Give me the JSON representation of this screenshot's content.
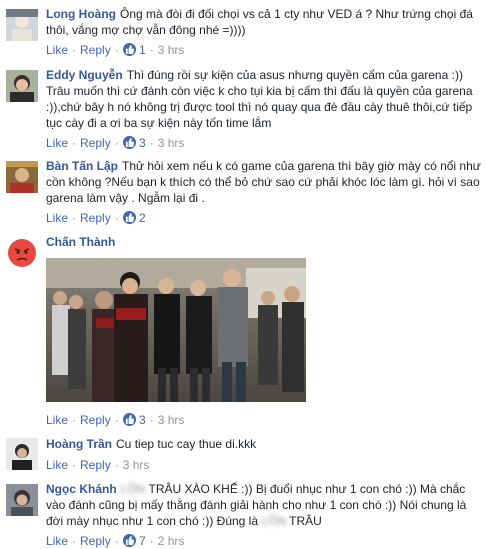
{
  "comments": [
    {
      "author": "Long Hoàng",
      "text": "Ông mà đòi đi đối chọi vs cả 1 cty như VED á ? Như trứng chọi đá thôi, vắng mợ chợ vẫn đông nhé =))))",
      "like_label": "Like",
      "reply_label": "Reply",
      "like_count": "1",
      "time": "3 hrs"
    },
    {
      "author": "Eddy Nguyễn",
      "text": "Thì đúng rồi sự kiện của asus nhưng quyền cấm của garena :)) Trâu muốn thì cứ đánh còn việc k cho tụi kia bị cấm thì đấu là quyền của garena :)),chứ bây h nó không trị được tool thì nó quay qua đè đầu cày thuê thôi,cứ tiếp tục cày đi a ơi ba sự kiện này tốn time lắm",
      "like_label": "Like",
      "reply_label": "Reply",
      "like_count": "3",
      "time": "3 hrs"
    },
    {
      "author": "Bàn Tấn Lập",
      "text": "Thử hỏi xem nếu k có game của garena thì bây giờ mày có nổi như cồn không ?Nếu bạn k thích có thể bỏ chứ sao cứ phải khóc lóc làm gì. hỏi vì sao garena làm vậy . Ngẫm lại đi .",
      "like_label": "Like",
      "reply_label": "Reply",
      "like_count": "2",
      "time": ""
    },
    {
      "author": "Chấn Thành",
      "text": "",
      "like_label": "Like",
      "reply_label": "Reply",
      "like_count": "3",
      "time": "3 hrs"
    },
    {
      "author": "Hoàng Trần",
      "text": "Cu tiep tuc cay thue di.kkk",
      "like_label": "Like",
      "reply_label": "Reply",
      "like_count": "",
      "time": "3 hrs"
    },
    {
      "author": "Ngọc Khánh",
      "author_blur": "LỒN",
      "text_a": "TRÂU XÀO KHẾ :)) Bị đuổi nhục như 1 con chó :)) Mà chắc vào đánh cũng bị mấy thằng đánh giải hành cho như 1 con chó :)) Nói chung là đời mày nhục như 1 con chó :)) Đúng là",
      "text_blur": "LỒN",
      "text_b": "TRÂU",
      "like_label": "Like",
      "reply_label": "Reply",
      "like_count": "7",
      "time": "2 hrs"
    }
  ],
  "colors": {
    "link": "#4267b2",
    "author": "#365899",
    "meta": "#90949c"
  },
  "icons": {
    "like": "thumbs-up-icon"
  }
}
